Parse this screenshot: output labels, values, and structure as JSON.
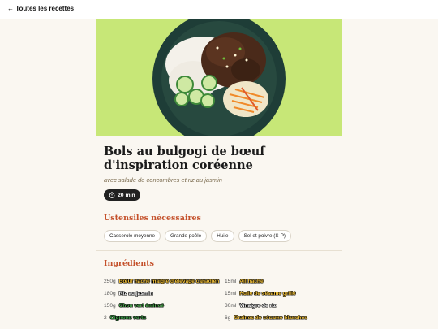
{
  "nav": {
    "back_label": "← Toutes les recettes"
  },
  "recipe": {
    "title": "Bols au bulgogi de bœuf d'inspiration coréenne",
    "subtitle": "avec salade de concombres et riz au jasmin",
    "time": "20 min"
  },
  "utensils": {
    "heading": "Ustensiles nécessaires",
    "items": [
      "Casserole moyenne",
      "Grande poêle",
      "Huile",
      "Sel et poivre (S-P)"
    ]
  },
  "ingredients": {
    "heading": "Ingrédients",
    "left": [
      {
        "qty": "250g",
        "name": "Bœuf haché maigre d'élevage canadien",
        "color": "#f2c13a"
      },
      {
        "qty": "180g",
        "name": "Riz au jasmin",
        "color": "#ffffff"
      },
      {
        "qty": "150g",
        "name": "Chou vert émincé",
        "color": "#4caf50"
      },
      {
        "qty": "2",
        "name": "Oignons verts",
        "color": "#3ea64a"
      }
    ],
    "right": [
      {
        "qty": "15ml",
        "name": "Ail haché",
        "color": "#f2c13a"
      },
      {
        "qty": "15ml",
        "name": "Huile de sésame grillé",
        "color": "#f2c13a"
      },
      {
        "qty": "30ml",
        "name": "Vinaigre de riz",
        "color": "#ffffff"
      },
      {
        "qty": "6g",
        "name": "Graines de sésame blanches",
        "color": "#f2c13a"
      }
    ]
  }
}
